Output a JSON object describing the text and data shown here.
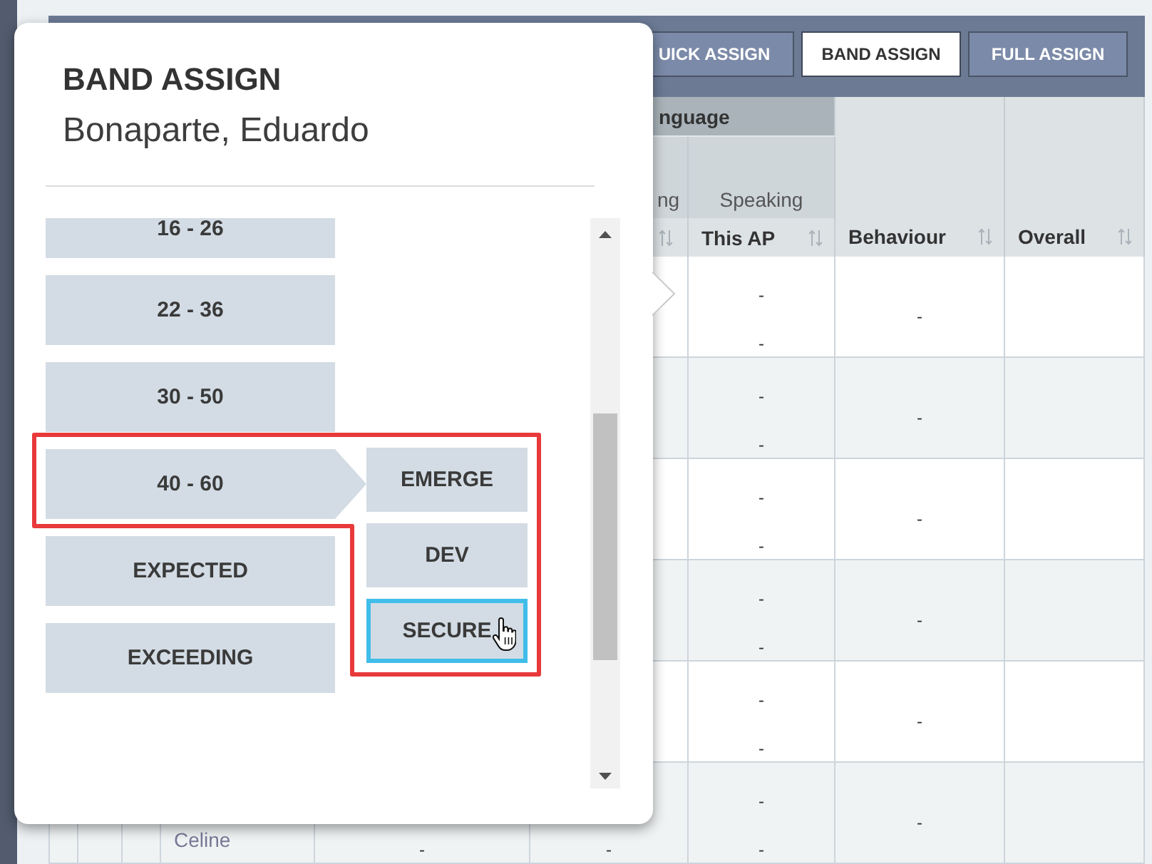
{
  "toolbar": {
    "buttons": [
      {
        "label": "UICK ASSIGN",
        "selected": false
      },
      {
        "label": "BAND ASSIGN",
        "selected": true
      },
      {
        "label": "FULL ASSIGN",
        "selected": false
      }
    ]
  },
  "table": {
    "column_group": "nguage",
    "column_6": {
      "heading": "ng",
      "sortable": true
    },
    "speaking_column": {
      "heading": "Speaking",
      "label": "This AP",
      "sortable": true
    },
    "behaviour_column": {
      "label": "Behaviour",
      "sortable": true
    },
    "overall_column": {
      "label": "Overall",
      "sortable": true
    },
    "rows": [
      {
        "speaking": {
          "upper": "-",
          "lower": "-"
        },
        "behaviour": "-"
      },
      {
        "speaking": {
          "upper": "-",
          "lower": "-"
        },
        "behaviour": "-"
      },
      {
        "speaking": {
          "upper": "-",
          "lower": "-"
        },
        "behaviour": "-"
      },
      {
        "speaking": {
          "upper": "-",
          "lower": "-"
        },
        "behaviour": "-"
      },
      {
        "speaking": {
          "upper": "-",
          "lower": "-"
        },
        "behaviour": "-"
      },
      {
        "column_4": "Celine",
        "column_5": {
          "lower": "-"
        },
        "column_6": {
          "lower": "-"
        },
        "speaking": {
          "upper": "-",
          "lower": "-"
        },
        "behaviour": "-"
      }
    ]
  },
  "popup": {
    "title": "BAND ASSIGN",
    "subtitle": "Bonaparte, Eduardo",
    "bands": [
      {
        "label": "16 - 26",
        "expanded": false
      },
      {
        "label": "22 - 36",
        "expanded": false
      },
      {
        "label": "30 - 50",
        "expanded": false
      },
      {
        "label": "40 - 60",
        "expanded": true,
        "levels": [
          {
            "label": "EMERGE",
            "selected": false
          },
          {
            "label": "DEV",
            "selected": false
          },
          {
            "label": "SECURE",
            "selected": true
          }
        ]
      },
      {
        "label": "EXPECTED",
        "expanded": false
      },
      {
        "label": "EXCEEDING",
        "expanded": false
      }
    ]
  }
}
